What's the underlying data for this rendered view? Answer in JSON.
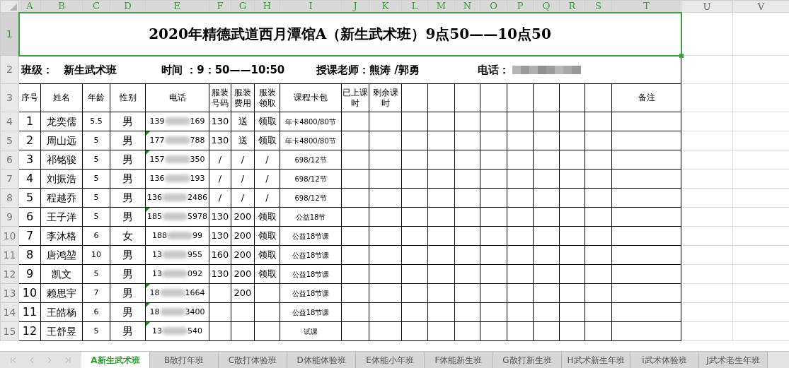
{
  "column_headers": [
    {
      "label": "A",
      "selected": true
    },
    {
      "label": "B",
      "selected": true
    },
    {
      "label": "C",
      "selected": true
    },
    {
      "label": "D",
      "selected": true
    },
    {
      "label": "E",
      "selected": true
    },
    {
      "label": "F",
      "selected": true
    },
    {
      "label": "G",
      "selected": true
    },
    {
      "label": "H",
      "selected": true
    },
    {
      "label": "I",
      "selected": true
    },
    {
      "label": "J",
      "selected": true
    },
    {
      "label": "K",
      "selected": true
    },
    {
      "label": "L",
      "selected": true
    },
    {
      "label": "M",
      "selected": true
    },
    {
      "label": "N",
      "selected": true
    },
    {
      "label": "O",
      "selected": true
    },
    {
      "label": "P",
      "selected": true
    },
    {
      "label": "Q",
      "selected": true
    },
    {
      "label": "R",
      "selected": true
    },
    {
      "label": "S",
      "selected": true
    },
    {
      "label": "T",
      "selected": true
    },
    {
      "label": "U",
      "selected": false
    },
    {
      "label": "V",
      "selected": false
    }
  ],
  "title_row": {
    "row_number": "1",
    "selected": true,
    "text": "2020年精德武道西月潭馆A（新生武术班）9点50——10点50"
  },
  "info_row": {
    "row_number": "2",
    "selected": false,
    "class_label": "班级：",
    "class_value": "新生武术班",
    "time": "时间 ：9：50——10:50",
    "teacher": "授课老师：熊涛 /郭勇",
    "phone_label": "电话："
  },
  "header_row": {
    "row_number": "3",
    "selected": false,
    "cells": [
      "序号",
      "姓名",
      "年龄",
      "性别",
      "电话",
      "服装号码",
      "服装费用",
      "服装领取",
      "课程卡包",
      "已上课时",
      "剩余课时",
      "备注"
    ]
  },
  "rows": [
    {
      "row_number": "4",
      "selected": false,
      "seq": "1",
      "name": "龙奕儒",
      "age": "5.5",
      "gender": "男",
      "phone": {
        "start": "139",
        "end": "169",
        "flagged": false
      },
      "uniform_size": "130",
      "uniform_fee": "送",
      "uniform_collected": "领取",
      "course_package": "年卡4800/80节"
    },
    {
      "row_number": "5",
      "selected": false,
      "seq": "2",
      "name": "周山远",
      "age": "5",
      "gender": "男",
      "phone": {
        "start": "177",
        "end": "788",
        "flagged": true
      },
      "uniform_size": "130",
      "uniform_fee": "送",
      "uniform_collected": "领取",
      "course_package": "年卡4800/80节"
    },
    {
      "row_number": "6",
      "selected": false,
      "seq": "3",
      "name": "祁铭骏",
      "age": "5",
      "gender": "男",
      "phone": {
        "start": "157",
        "end": "350",
        "flagged": true
      },
      "uniform_size": "/",
      "uniform_fee": "/",
      "uniform_collected": "/",
      "course_package": "698/12节"
    },
    {
      "row_number": "7",
      "selected": false,
      "seq": "4",
      "name": "刘振浩",
      "age": "5",
      "gender": "男",
      "phone": {
        "start": "136",
        "end": "193",
        "flagged": false
      },
      "uniform_size": "/",
      "uniform_fee": "/",
      "uniform_collected": "/",
      "course_package": "698/12节"
    },
    {
      "row_number": "8",
      "selected": false,
      "seq": "5",
      "name": "程越乔",
      "age": "5",
      "gender": "男",
      "phone": {
        "start": "136",
        "end": "2486",
        "flagged": false
      },
      "uniform_size": "/",
      "uniform_fee": "/",
      "uniform_collected": "/",
      "course_package": "698/12节"
    },
    {
      "row_number": "9",
      "selected": false,
      "seq": "6",
      "name": "王子洋",
      "age": "5",
      "gender": "男",
      "phone": {
        "start": "185",
        "end": "5978",
        "flagged": true
      },
      "uniform_size": "130",
      "uniform_fee": "200",
      "uniform_collected": "领取",
      "course_package": "公益18节"
    },
    {
      "row_number": "10",
      "selected": false,
      "seq": "7",
      "name": "李沐格",
      "age": "6",
      "gender": "女",
      "phone": {
        "start": "188",
        "end": "99",
        "flagged": false
      },
      "uniform_size": "130",
      "uniform_fee": "200",
      "uniform_collected": "领取",
      "course_package": "公益18节课"
    },
    {
      "row_number": "11",
      "selected": false,
      "seq": "8",
      "name": "唐鸿堃",
      "age": "10",
      "gender": "男",
      "phone": {
        "start": "13",
        "end": "955",
        "flagged": false
      },
      "uniform_size": "160",
      "uniform_fee": "200",
      "uniform_collected": "领取",
      "course_package": "公益18节课"
    },
    {
      "row_number": "12",
      "selected": false,
      "seq": "9",
      "name": "凯文",
      "age": "5",
      "gender": "男",
      "phone": {
        "start": "13",
        "end": "092",
        "flagged": false
      },
      "uniform_size": "130",
      "uniform_fee": "200",
      "uniform_collected": "领取",
      "course_package": "公益18节课"
    },
    {
      "row_number": "13",
      "selected": false,
      "seq": "10",
      "name": "赖思宇",
      "age": "7",
      "gender": "男",
      "phone": {
        "start": "18",
        "end": "1664",
        "flagged": true
      },
      "uniform_fee": "200",
      "course_package": "公益18节课"
    },
    {
      "row_number": "14",
      "selected": false,
      "seq": "11",
      "name": "王皓杨",
      "age": "6",
      "gender": "男",
      "phone": {
        "start": "18",
        "end": "3400",
        "flagged": true
      },
      "course_package": "公益18节课"
    },
    {
      "row_number": "15",
      "selected": false,
      "seq": "12",
      "name": "王舒昱",
      "age": "5",
      "gender": "男",
      "phone": {
        "start": "13",
        "end": "540",
        "flagged": true
      },
      "course_package": "试课"
    }
  ],
  "sheet_tabs": [
    {
      "label": "A新生武术班",
      "selected": true
    },
    {
      "label": "B散打年班",
      "selected": false
    },
    {
      "label": "C散打体验班",
      "selected": false
    },
    {
      "label": "D体能体验班",
      "selected": false
    },
    {
      "label": "E体能小年班",
      "selected": false
    },
    {
      "label": "F体能新生班",
      "selected": false
    },
    {
      "label": "G散打新生班",
      "selected": false
    },
    {
      "label": "H武术新生年班",
      "selected": false
    },
    {
      "label": "i武术体验班",
      "selected": false
    },
    {
      "label": "J武术老生年班",
      "selected": false
    }
  ]
}
